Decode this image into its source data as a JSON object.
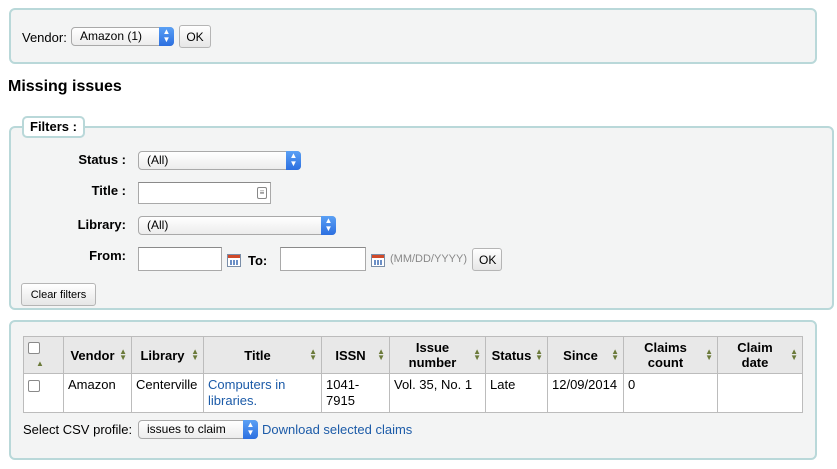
{
  "vendor_bar": {
    "label": "Vendor:",
    "selected": "Amazon (1)",
    "ok_label": "OK"
  },
  "page_title": "Missing issues",
  "filters": {
    "legend": "Filters :",
    "status_label": "Status :",
    "status_value": "(All)",
    "title_label": "Title :",
    "title_value": "",
    "library_label": "Library:",
    "library_value": "(All)",
    "from_label": "From:",
    "from_value": "",
    "to_label": "To:",
    "to_value": "",
    "date_format_hint": "(MM/DD/YYYY)",
    "ok_label": "OK",
    "clear_label": "Clear filters"
  },
  "table": {
    "columns": [
      "",
      "Vendor",
      "Library",
      "Title",
      "ISSN",
      "Issue number",
      "Status",
      "Since",
      "Claims count",
      "Claim date"
    ],
    "rows": [
      {
        "vendor": "Amazon",
        "library": "Centerville",
        "title": "Computers in libraries.",
        "issn": "1041-7915",
        "issue_number": "Vol. 35, No. 1",
        "status": "Late",
        "since": "12/09/2014",
        "claims_count": "0",
        "claim_date": ""
      }
    ]
  },
  "csv": {
    "label": "Select CSV profile:",
    "selected": "issues to claim",
    "download_label": "Download selected claims"
  },
  "colors": {
    "panel_bg": "#f3f4f4",
    "panel_border": "#b9d8d9",
    "link": "#1c5ba8",
    "header_bg": "#e8e8e8"
  },
  "icons": [
    "select-arrows-icon",
    "calendar-icon",
    "text-field-icon",
    "sort-icon"
  ]
}
